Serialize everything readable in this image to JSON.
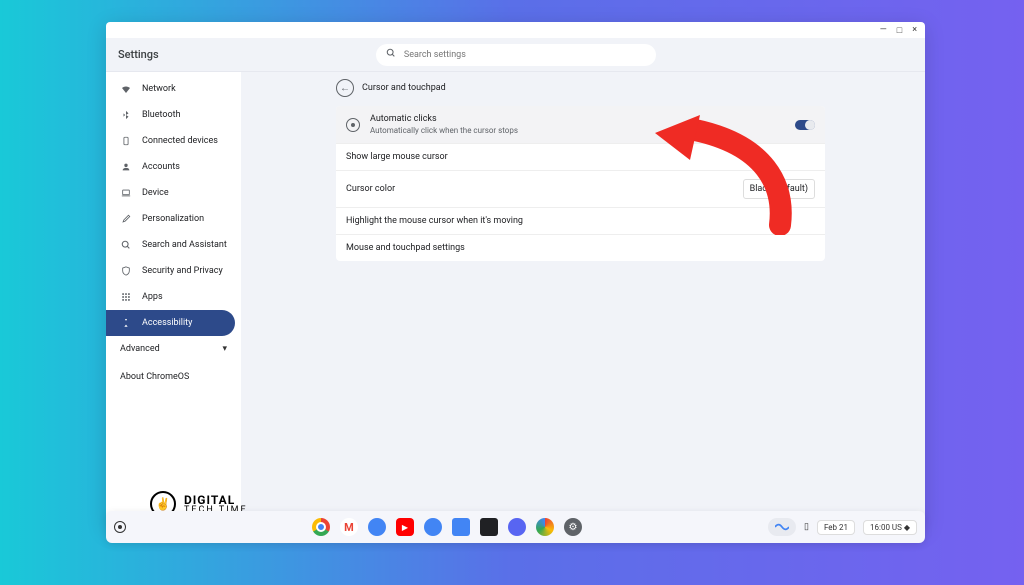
{
  "window_controls": {
    "minimize": "—",
    "maximize": "□",
    "close": "×"
  },
  "header": {
    "title": "Settings",
    "search_placeholder": "Search settings"
  },
  "sidebar": {
    "items": [
      {
        "label": "Network",
        "icon": "wifi-icon"
      },
      {
        "label": "Bluetooth",
        "icon": "bluetooth-icon"
      },
      {
        "label": "Connected devices",
        "icon": "devices-icon"
      },
      {
        "label": "Accounts",
        "icon": "account-icon"
      },
      {
        "label": "Device",
        "icon": "laptop-icon"
      },
      {
        "label": "Personalization",
        "icon": "brush-icon"
      },
      {
        "label": "Search and Assistant",
        "icon": "search-icon"
      },
      {
        "label": "Security and Privacy",
        "icon": "shield-icon"
      },
      {
        "label": "Apps",
        "icon": "apps-icon"
      },
      {
        "label": "Accessibility",
        "icon": "accessibility-icon"
      }
    ],
    "advanced": "Advanced",
    "about": "About ChromeOS"
  },
  "main": {
    "page_title": "Cursor and touchpad",
    "rows": [
      {
        "title": "Automatic clicks",
        "subtitle": "Automatically click when the cursor stops"
      },
      {
        "title": "Show large mouse cursor"
      },
      {
        "title": "Cursor color",
        "value": "Black (default)"
      },
      {
        "title": "Highlight the mouse cursor when it's moving"
      },
      {
        "title": "Mouse and touchpad settings"
      }
    ]
  },
  "watermark": {
    "line1": "DIGITAL",
    "line2": "TECH TIME"
  },
  "shelf": {
    "apps": [
      "chrome-icon",
      "gmail-icon",
      "chat-icon",
      "youtube-icon",
      "files-icon",
      "docs-icon",
      "terminal-icon",
      "discord-icon",
      "photos-icon",
      "settings-icon"
    ],
    "date": "Feb 21",
    "time": "16:00 US"
  }
}
